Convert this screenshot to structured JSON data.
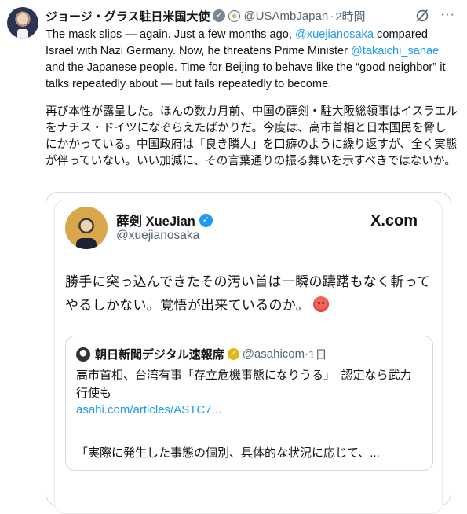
{
  "tweet": {
    "author_name": "ジョージ・グラス駐日米国大使",
    "handle": "@USAmbJapan",
    "separator": "·",
    "time": "2時間",
    "more": "···",
    "text_en": {
      "p1": "The mask slips — again. Just a few months ago, ",
      "m1": "@xuejianosaka",
      "p2": " compared Israel with Nazi Germany. Now, he threatens Prime Minister ",
      "m2": "@takaichi_sanae",
      "p3": " and the Japanese people. Time for Beijing to behave like the “good neighbor” it talks repeatedly about — but fails repeatedly to become."
    },
    "text_jp": "再び本性が露呈した。ほんの数カ月前、中国の薛剣・駐大阪総領事はイスラエルをナチス・ドイツになぞらえたばかりだ。今度は、高市首相と日本国民を脅しにかかっている。中国政府は「良き隣人」を口癖のように繰り返すが、全く実態が伴っていない。いい加減に、その言葉通りの振る舞いを示すべきではないか。"
  },
  "quoted": {
    "name": "薛剣 XueJian",
    "handle": "@xuejianosaka",
    "site": "X.com",
    "text": "勝手に突っ込んできたその汚い首は一瞬の躊躇もなく斬ってやるしかない。覚悟が出来ているのか。",
    "nested": {
      "name": "朝日新聞デジタル速報席",
      "handle": "@asahicom",
      "separator": "·",
      "time": "1日",
      "text": "高市首相、台湾有事「存立危機事態になりうる」　認定なら武力行使も",
      "link": "asahi.com/articles/ASTC7...",
      "quote": "「実際に発生した事態の個別、具体的な状況に応じて、..."
    }
  },
  "icons": {
    "badge": "government-badge-icon",
    "seal": "us-seal-icon",
    "grok": "grok-icon",
    "more": "more-icon",
    "verified": "verified-check-icon",
    "gold": "gold-check-icon",
    "angry": "angry-face-emoji"
  },
  "colors": {
    "link": "#1d9bf0",
    "secondary_text": "#536471",
    "text": "#0f1419",
    "border": "#cfd9de"
  }
}
